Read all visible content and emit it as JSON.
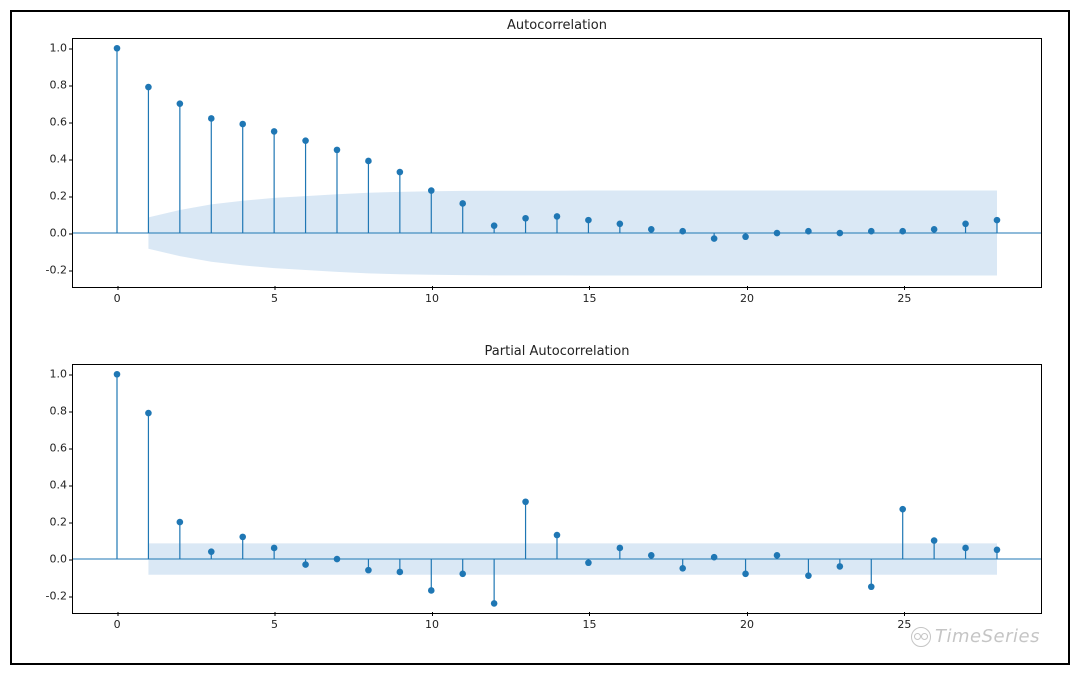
{
  "watermark": "TimeSeries",
  "chart_data": [
    {
      "type": "stem",
      "title": "Autocorrelation",
      "x": [
        0,
        1,
        2,
        3,
        4,
        5,
        6,
        7,
        8,
        9,
        10,
        11,
        12,
        13,
        14,
        15,
        16,
        17,
        18,
        19,
        20,
        21,
        22,
        23,
        24,
        25,
        26,
        27,
        28
      ],
      "values": [
        1.0,
        0.79,
        0.7,
        0.62,
        0.59,
        0.55,
        0.5,
        0.45,
        0.39,
        0.33,
        0.23,
        0.16,
        0.04,
        0.08,
        0.09,
        0.07,
        0.05,
        0.02,
        0.01,
        -0.03,
        -0.02,
        0.0,
        0.01,
        0.0,
        0.01,
        0.01,
        0.02,
        0.05,
        0.07
      ],
      "ci_upper": [
        0.0,
        0.085,
        0.125,
        0.155,
        0.175,
        0.19,
        0.2,
        0.21,
        0.218,
        0.223,
        0.226,
        0.228,
        0.229,
        0.229,
        0.229,
        0.23,
        0.23,
        0.23,
        0.23,
        0.23,
        0.23,
        0.23,
        0.23,
        0.23,
        0.23,
        0.23,
        0.23,
        0.23,
        0.23
      ],
      "ci_lower": [
        0.0,
        -0.085,
        -0.125,
        -0.155,
        -0.175,
        -0.19,
        -0.2,
        -0.21,
        -0.218,
        -0.223,
        -0.226,
        -0.228,
        -0.229,
        -0.229,
        -0.229,
        -0.23,
        -0.23,
        -0.23,
        -0.23,
        -0.23,
        -0.23,
        -0.23,
        -0.23,
        -0.23,
        -0.23,
        -0.23,
        -0.23,
        -0.23,
        -0.23
      ],
      "xlabel": "",
      "ylabel": "",
      "xlim": [
        -1.4,
        29.4
      ],
      "ylim": [
        -0.3,
        1.05
      ],
      "xticks": [
        0,
        5,
        10,
        15,
        20,
        25
      ],
      "yticks": [
        -0.2,
        0.0,
        0.2,
        0.4,
        0.6,
        0.8,
        1.0
      ]
    },
    {
      "type": "stem",
      "title": "Partial Autocorrelation",
      "x": [
        0,
        1,
        2,
        3,
        4,
        5,
        6,
        7,
        8,
        9,
        10,
        11,
        12,
        13,
        14,
        15,
        16,
        17,
        18,
        19,
        20,
        21,
        22,
        23,
        24,
        25,
        26,
        27,
        28
      ],
      "values": [
        1.0,
        0.79,
        0.2,
        0.04,
        0.12,
        0.06,
        -0.03,
        0.0,
        -0.06,
        -0.07,
        -0.17,
        -0.08,
        -0.24,
        0.31,
        0.13,
        -0.02,
        0.06,
        0.02,
        -0.05,
        0.01,
        -0.08,
        0.02,
        -0.09,
        -0.04,
        -0.15,
        0.27,
        0.1,
        0.06,
        0.05
      ],
      "ci_upper": [
        0.0,
        0.085,
        0.085,
        0.085,
        0.085,
        0.085,
        0.085,
        0.085,
        0.085,
        0.085,
        0.085,
        0.085,
        0.085,
        0.085,
        0.085,
        0.085,
        0.085,
        0.085,
        0.085,
        0.085,
        0.085,
        0.085,
        0.085,
        0.085,
        0.085,
        0.085,
        0.085,
        0.085,
        0.085
      ],
      "ci_lower": [
        0.0,
        -0.085,
        -0.085,
        -0.085,
        -0.085,
        -0.085,
        -0.085,
        -0.085,
        -0.085,
        -0.085,
        -0.085,
        -0.085,
        -0.085,
        -0.085,
        -0.085,
        -0.085,
        -0.085,
        -0.085,
        -0.085,
        -0.085,
        -0.085,
        -0.085,
        -0.085,
        -0.085,
        -0.085,
        -0.085,
        -0.085,
        -0.085,
        -0.085
      ],
      "xlabel": "",
      "ylabel": "",
      "xlim": [
        -1.4,
        29.4
      ],
      "ylim": [
        -0.3,
        1.05
      ],
      "xticks": [
        0,
        5,
        10,
        15,
        20,
        25
      ],
      "yticks": [
        -0.2,
        0.0,
        0.2,
        0.4,
        0.6,
        0.8,
        1.0
      ]
    }
  ]
}
